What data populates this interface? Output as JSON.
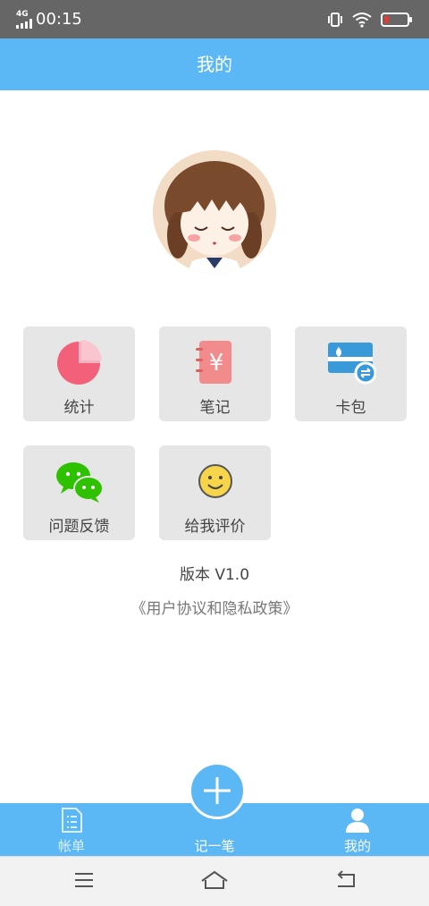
{
  "status_bar": {
    "network": "4G",
    "time": "00:15"
  },
  "header": {
    "title": "我的"
  },
  "grid": [
    {
      "label": "统计",
      "icon": "pie-chart-icon"
    },
    {
      "label": "笔记",
      "icon": "yuan-notebook-icon"
    },
    {
      "label": "卡包",
      "icon": "card-wallet-icon"
    },
    {
      "label": "问题反馈",
      "icon": "wechat-icon"
    },
    {
      "label": "给我评价",
      "icon": "smiley-icon"
    }
  ],
  "version": "版本 V1.0",
  "policy_link": "《用户协议和隐私政策》",
  "tabs": [
    {
      "label": "帐单",
      "icon": "bill-icon",
      "active": false
    },
    {
      "label": "记一笔",
      "icon": "plus-icon",
      "active": false
    },
    {
      "label": "我的",
      "icon": "person-icon",
      "active": true
    }
  ],
  "colors": {
    "accent": "#5bb8f5",
    "statusbar": "#666666",
    "tile": "#e6e6e6",
    "pie": "#f2607a",
    "card": "#3a9ad9",
    "wechat": "#2dc100",
    "smiley": "#f6d54a",
    "battery_low": "#e53935",
    "tab_inactive": "#d9efff",
    "tab_active": "#ffffff"
  }
}
